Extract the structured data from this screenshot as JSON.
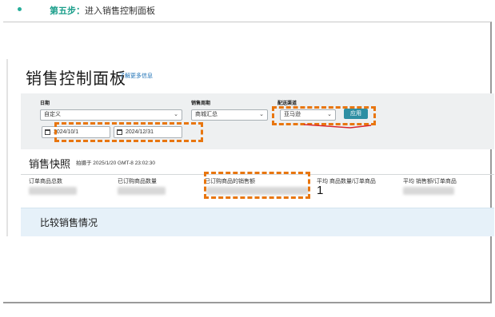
{
  "instruction": {
    "step_label": "第五步：",
    "step_text": "进入销售控制面板"
  },
  "page": {
    "title": "销售控制面板",
    "learn_more": "了解更多信息"
  },
  "filters": {
    "date_label": "日期",
    "date_preset": "自定义",
    "start_date": "2024/10/1",
    "end_date": "2024/12/31",
    "sales_period_label": "销售周期",
    "sales_period_value": "商城汇总",
    "channel_label": "配送渠道",
    "channel_value": "亚马逊",
    "apply_label": "应用"
  },
  "snapshot": {
    "title": "销售快照",
    "captured_at": "拍摄于 2025/1/20 GMT-8 23:02:30",
    "metrics": [
      {
        "label": "订单商品总数",
        "value": ""
      },
      {
        "label": "已订购商品数量",
        "value": ""
      },
      {
        "label": "已订购商品的销售额",
        "value": ""
      },
      {
        "label": "平均 商品数量/订单商品",
        "value": "1"
      },
      {
        "label": "平均 销售额/订单商品",
        "value": ""
      }
    ]
  },
  "compare": {
    "title": "比较销售情况"
  },
  "colors": {
    "accent": "#2e8fa3",
    "annotation": "#e8760f",
    "step_green": "#1a9e8a"
  },
  "icons": [
    "bullet-dot-icon",
    "calendar-icon",
    "chevron-down-icon"
  ]
}
